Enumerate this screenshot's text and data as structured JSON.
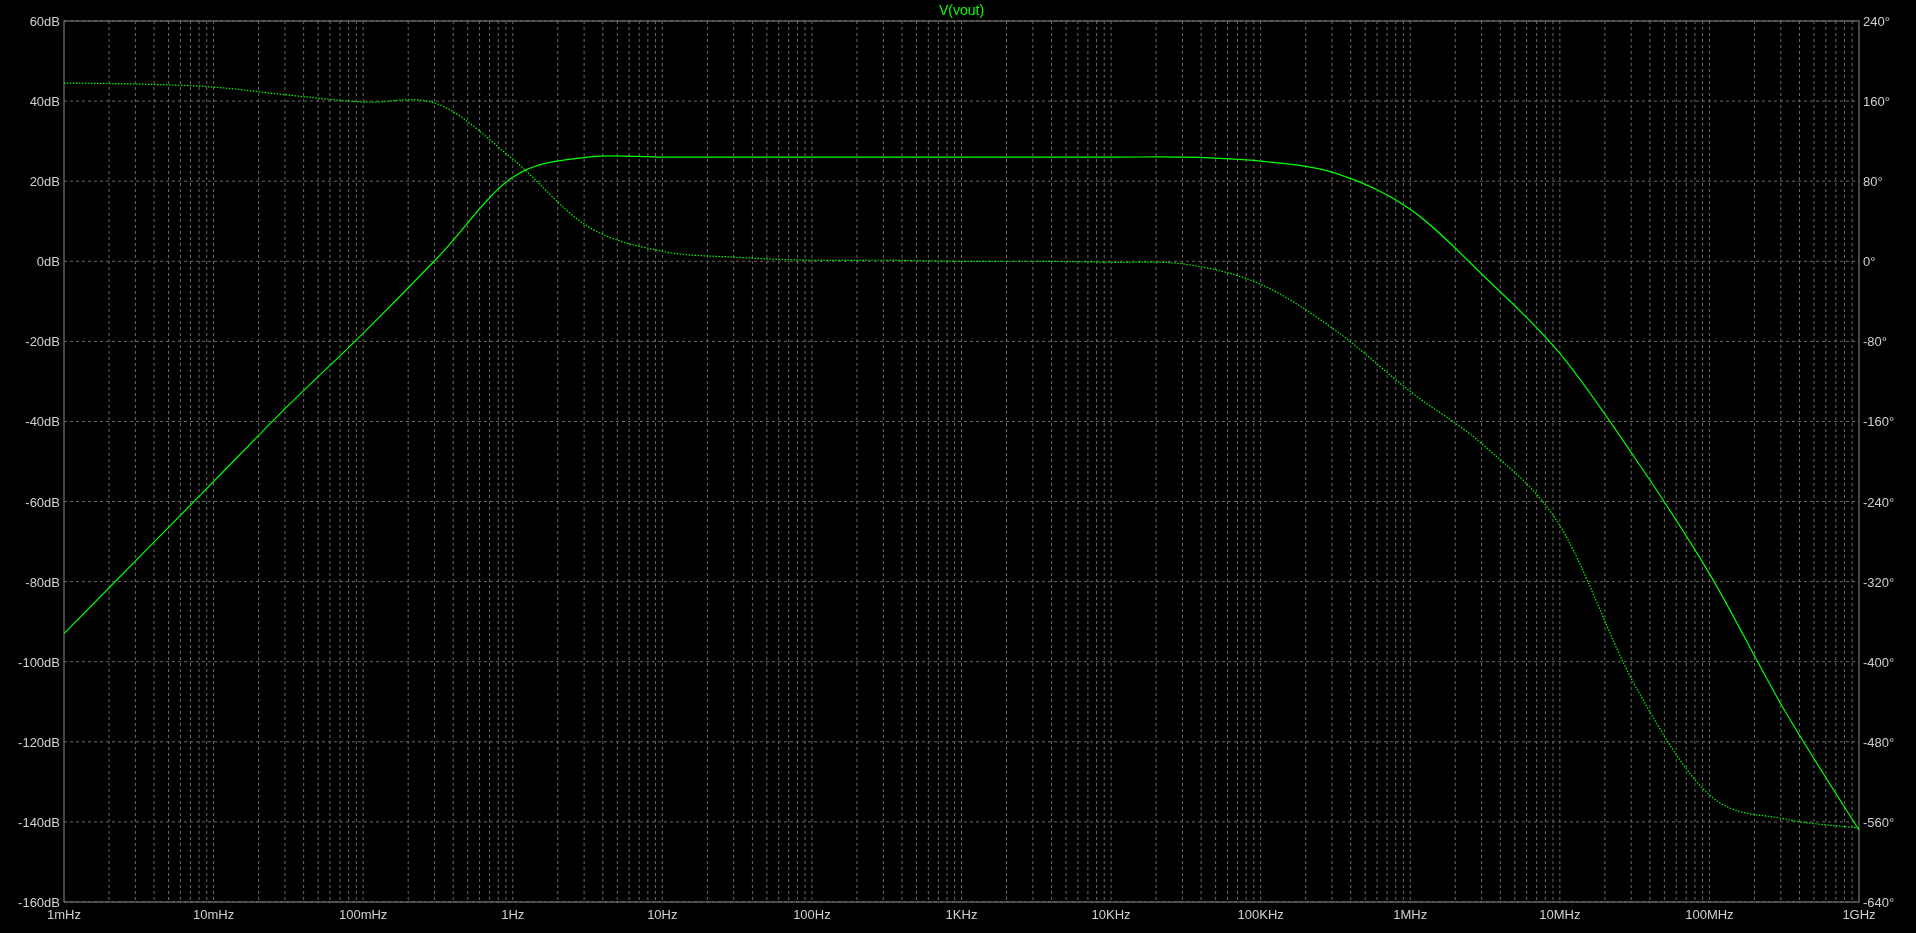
{
  "plot": {
    "chart_data": {
      "type": "line",
      "title": "V(vout)",
      "categories": [
        "1mHz",
        null,
        "10mHz",
        null,
        "100mHz",
        null,
        "1Hz",
        null,
        "10Hz",
        null,
        "100Hz",
        null,
        "1KHz",
        null,
        "10KHz",
        null,
        "100KHz",
        null,
        "1MHz",
        null,
        "10MHz",
        null,
        "100MHz",
        null,
        "1GHz"
      ],
      "series": [
        {
          "color": "#00ff00",
          "line_style": "solid",
          "values": [
            -93,
            -74,
            -55,
            -36,
            -18,
            1,
            21,
            26,
            26,
            26,
            26,
            26,
            26,
            26,
            26,
            26,
            25,
            22,
            13,
            -4,
            -23,
            -49,
            -78,
            -112,
            -142
          ]
        },
        {
          "color": "#00ff00",
          "axis": "y2",
          "line_style": "dotted",
          "values": [
            178,
            177,
            174,
            166,
            159,
            157,
            102,
            35,
            10,
            4,
            1,
            1,
            0,
            0,
            -1,
            -3,
            -23,
            -69,
            -130,
            -185,
            -264,
            -423,
            -533,
            -557,
            -566
          ]
        }
      ],
      "grid": true,
      "ylim": [
        -160,
        60
      ],
      "yticks": [
        {
          "value": 60,
          "label": "60dB"
        },
        {
          "value": 40,
          "label": "40dB"
        },
        {
          "value": 20,
          "label": "20dB"
        },
        {
          "value": 0,
          "label": "0dB"
        },
        {
          "value": -20,
          "label": "-20dB"
        },
        {
          "value": -40,
          "label": "-40dB"
        },
        {
          "value": -60,
          "label": "-60dB"
        },
        {
          "value": -80,
          "label": "-80dB"
        },
        {
          "value": -100,
          "label": "-100dB"
        },
        {
          "value": -120,
          "label": "-120dB"
        },
        {
          "value": -140,
          "label": "-140dB"
        },
        {
          "value": -160,
          "label": "-160dB"
        }
      ],
      "y2lim": [
        -640,
        240
      ],
      "y2ticks": [
        {
          "value": 240,
          "label": "240°"
        },
        {
          "value": 160,
          "label": "160°"
        },
        {
          "value": 80,
          "label": "80°"
        },
        {
          "value": 0,
          "label": "0°"
        },
        {
          "value": -80,
          "label": "-80°"
        },
        {
          "value": -160,
          "label": "-160°"
        },
        {
          "value": -240,
          "label": "-240°"
        },
        {
          "value": -320,
          "label": "-320°"
        },
        {
          "value": -400,
          "label": "-400°"
        },
        {
          "value": -480,
          "label": "-480°"
        },
        {
          "value": -560,
          "label": "-560°"
        },
        {
          "value": -640,
          "label": "-640°"
        }
      ]
    }
  }
}
